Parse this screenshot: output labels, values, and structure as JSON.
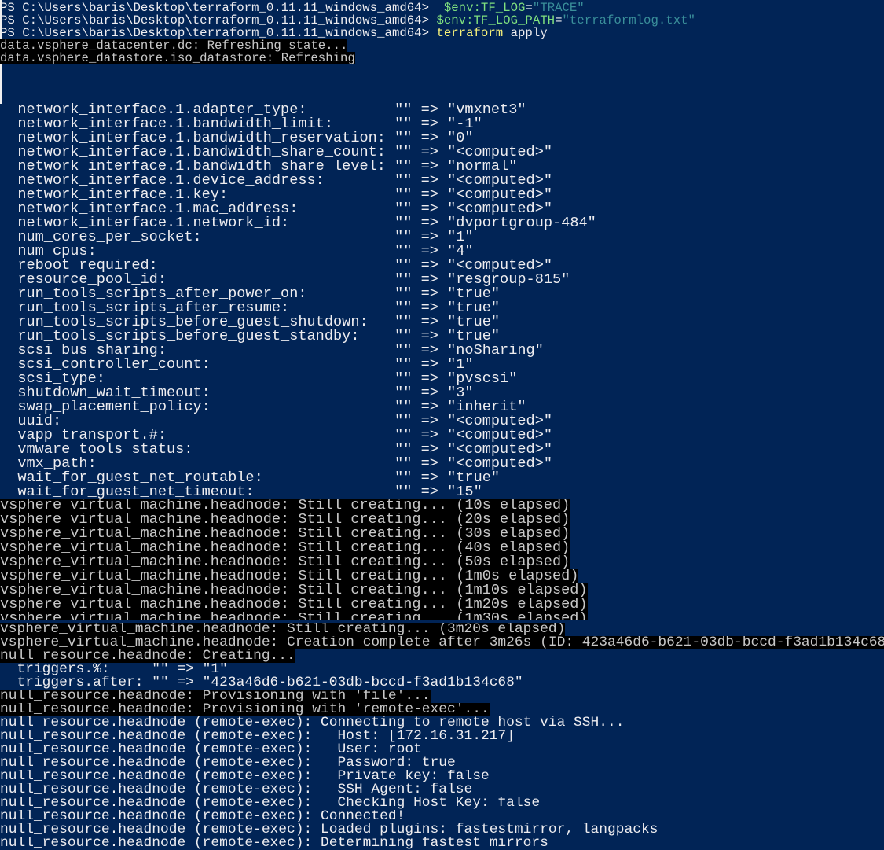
{
  "window": {
    "title": "Windows PowerShell"
  },
  "prompt": "PS C:\\Users\\baris\\Desktop\\terraform_0.11.11_windows_amd64> ",
  "commands": [
    {
      "var": " $env:TF_LOG",
      "eq": "=",
      "str": "\"TRACE\"",
      "kw": "",
      "arg": ""
    },
    {
      "var": "$env:TF_LOG_PATH",
      "eq": "=",
      "str": "\"terraformlog.txt\"",
      "kw": "",
      "arg": ""
    },
    {
      "var": "",
      "eq": "",
      "str": "",
      "kw": "terraform",
      "arg": " apply"
    }
  ],
  "refresh_lines": [
    "data.vsphere_datacenter.dc: Refreshing state...",
    "data.vsphere_datastore.iso_datastore: Refreshing"
  ],
  "attributes": [
    {
      "name": "network_interface.1.adapter_type:",
      "old": "\"\"",
      "value": "\"vmxnet3\""
    },
    {
      "name": "network_interface.1.bandwidth_limit:",
      "old": "\"\"",
      "value": "\"-1\""
    },
    {
      "name": "network_interface.1.bandwidth_reservation:",
      "old": "\"\"",
      "value": "\"0\""
    },
    {
      "name": "network_interface.1.bandwidth_share_count:",
      "old": "\"\"",
      "value": "\"<computed>\""
    },
    {
      "name": "network_interface.1.bandwidth_share_level:",
      "old": "\"\"",
      "value": "\"normal\""
    },
    {
      "name": "network_interface.1.device_address:",
      "old": "\"\"",
      "value": "\"<computed>\""
    },
    {
      "name": "network_interface.1.key:",
      "old": "\"\"",
      "value": "\"<computed>\""
    },
    {
      "name": "network_interface.1.mac_address:",
      "old": "\"\"",
      "value": "\"<computed>\""
    },
    {
      "name": "network_interface.1.network_id:",
      "old": "\"\"",
      "value": "\"dvportgroup-484\""
    },
    {
      "name": "num_cores_per_socket:",
      "old": "\"\"",
      "value": "\"1\""
    },
    {
      "name": "num_cpus:",
      "old": "\"\"",
      "value": "\"4\""
    },
    {
      "name": "reboot_required:",
      "old": "\"\"",
      "value": "\"<computed>\""
    },
    {
      "name": "resource_pool_id:",
      "old": "\"\"",
      "value": "\"resgroup-815\""
    },
    {
      "name": "run_tools_scripts_after_power_on:",
      "old": "\"\"",
      "value": "\"true\""
    },
    {
      "name": "run_tools_scripts_after_resume:",
      "old": "\"\"",
      "value": "\"true\""
    },
    {
      "name": "run_tools_scripts_before_guest_shutdown:",
      "old": "\"\"",
      "value": "\"true\""
    },
    {
      "name": "run_tools_scripts_before_guest_standby:",
      "old": "\"\"",
      "value": "\"true\""
    },
    {
      "name": "scsi_bus_sharing:",
      "old": "\"\"",
      "value": "\"noSharing\""
    },
    {
      "name": "scsi_controller_count:",
      "old": "\"\"",
      "value": "\"1\""
    },
    {
      "name": "scsi_type:",
      "old": "\"\"",
      "value": "\"pvscsi\""
    },
    {
      "name": "shutdown_wait_timeout:",
      "old": "\"\"",
      "value": "\"3\""
    },
    {
      "name": "swap_placement_policy:",
      "old": "\"\"",
      "value": "\"inherit\""
    },
    {
      "name": "uuid:",
      "old": "\"\"",
      "value": "\"<computed>\""
    },
    {
      "name": "vapp_transport.#:",
      "old": "\"\"",
      "value": "\"<computed>\""
    },
    {
      "name": "vmware_tools_status:",
      "old": "\"\"",
      "value": "\"<computed>\""
    },
    {
      "name": "vmx_path:",
      "old": "\"\"",
      "value": "\"<computed>\""
    },
    {
      "name": "wait_for_guest_net_routable:",
      "old": "\"\"",
      "value": "\"true\""
    },
    {
      "name": "wait_for_guest_net_timeout:",
      "old": "\"\"",
      "value": "\"15\""
    }
  ],
  "arrow": "=>",
  "creating_lines": [
    "vsphere_virtual_machine.headnode: Still creating... (10s elapsed)",
    "vsphere_virtual_machine.headnode: Still creating... (20s elapsed)",
    "vsphere_virtual_machine.headnode: Still creating... (30s elapsed)",
    "vsphere_virtual_machine.headnode: Still creating... (40s elapsed)",
    "vsphere_virtual_machine.headnode: Still creating... (50s elapsed)",
    "vsphere_virtual_machine.headnode: Still creating... (1m0s elapsed)",
    "vsphere_virtual_machine.headnode: Still creating... (1m10s elapsed)",
    "vsphere_virtual_machine.headnode: Still creating... (1m20s elapsed)",
    "vsphere_virtual_machine.headnode: Still creating... (1m30s elapsed)"
  ],
  "tail_lines": [
    {
      "text": "vsphere_virtual_machine.headnode: Still creating... (3m20s elapsed)",
      "hl": true
    },
    {
      "text": "vsphere_virtual_machine.headnode: Creation complete after 3m26s (ID: 423a46d6-b621-03db-bccd-f3ad1b134c68)",
      "hl": true
    },
    {
      "text": "null_resource.headnode: Creating...",
      "hl": true
    },
    {
      "text": "  triggers.%:     \"\" => \"1\"",
      "hl": false
    },
    {
      "text": "  triggers.after: \"\" => \"423a46d6-b621-03db-bccd-f3ad1b134c68\"",
      "hl": false
    },
    {
      "text": "null_resource.headnode: Provisioning with 'file'...",
      "hl": true
    },
    {
      "text": "null_resource.headnode: Provisioning with 'remote-exec'...",
      "hl": true
    },
    {
      "text": "null_resource.headnode (remote-exec): Connecting to remote host via SSH...",
      "hl": false
    },
    {
      "text": "null_resource.headnode (remote-exec):   Host: [172.16.31.217]",
      "hl": false
    },
    {
      "text": "null_resource.headnode (remote-exec):   User: root",
      "hl": false
    },
    {
      "text": "null_resource.headnode (remote-exec):   Password: true",
      "hl": false
    },
    {
      "text": "null_resource.headnode (remote-exec):   Private key: false",
      "hl": false
    },
    {
      "text": "null_resource.headnode (remote-exec):   SSH Agent: false",
      "hl": false
    },
    {
      "text": "null_resource.headnode (remote-exec):   Checking Host Key: false",
      "hl": false
    },
    {
      "text": "null_resource.headnode (remote-exec): Connected!",
      "hl": false
    },
    {
      "text": "null_resource.headnode (remote-exec): Loaded plugins: fastestmirror, langpacks",
      "hl": false
    },
    {
      "text": "null_resource.headnode (remote-exec): Determining fastest mirrors",
      "hl": false
    }
  ]
}
